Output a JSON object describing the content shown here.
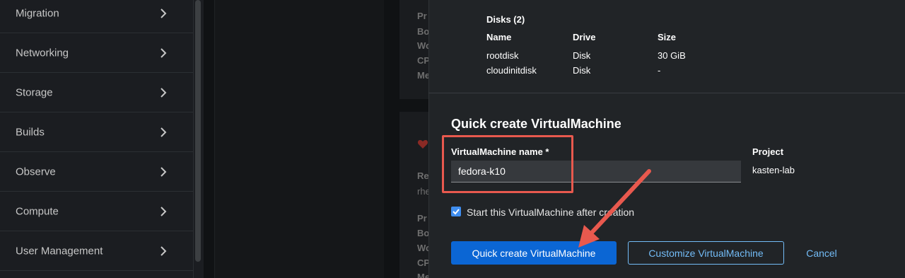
{
  "sidebar": {
    "items": [
      {
        "label": "Migration"
      },
      {
        "label": "Networking"
      },
      {
        "label": "Storage"
      },
      {
        "label": "Builds"
      },
      {
        "label": "Observe"
      },
      {
        "label": "Compute"
      },
      {
        "label": "User Management"
      }
    ]
  },
  "background": {
    "fragments": [
      "Pr",
      "Bo",
      "Wo",
      "CP",
      "Me",
      "Re",
      "rhe",
      "Pr",
      "Bo",
      "Wo",
      "CP",
      "Me"
    ]
  },
  "disks": {
    "title": "Disks (2)",
    "headers": [
      "Name",
      "Drive",
      "Size"
    ],
    "rows": [
      [
        "rootdisk",
        "Disk",
        "30 GiB"
      ],
      [
        "cloudinitdisk",
        "Disk",
        "-"
      ]
    ]
  },
  "form": {
    "title": "Quick create VirtualMachine",
    "name_label": "VirtualMachine name *",
    "name_value": "fedora-k10",
    "project_label": "Project",
    "project_value": "kasten-lab",
    "start_checkbox_label": "Start this VirtualMachine after creation",
    "start_checked": true
  },
  "actions": {
    "primary": "Quick create VirtualMachine",
    "secondary": "Customize VirtualMachine",
    "cancel": "Cancel"
  },
  "colors": {
    "primary_button": "#0b66d4",
    "link": "#73bcf7",
    "annotation": "#e8594e"
  }
}
